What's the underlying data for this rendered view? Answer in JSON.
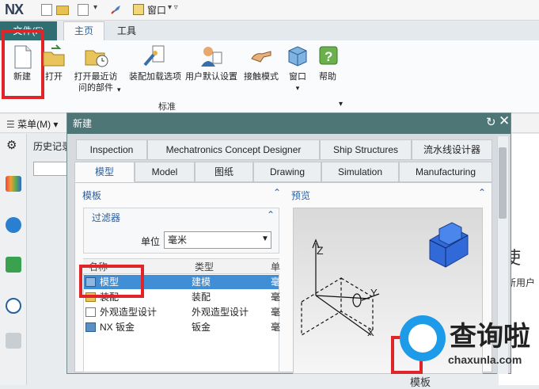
{
  "titlebar": {
    "logo": "NX",
    "window_label": "窗口"
  },
  "ribbon": {
    "tabs": {
      "file": "文件(F)",
      "home": "主页",
      "tools": "工具"
    },
    "buttons": {
      "new": "新建",
      "open": "打开",
      "open_recent_1": "打开最近访",
      "open_recent_2": "问的部件",
      "assembly_load": "装配加载选项",
      "user_defaults": "用户默认设置",
      "touch_mode": "接触模式",
      "window": "窗口",
      "help": "帮助"
    },
    "group_label": "标准"
  },
  "menubar": {
    "menu": "菜单(M)"
  },
  "background": {
    "history": "历史记录",
    "right_big": "使",
    "right_small": "新用户"
  },
  "dialog": {
    "title": "新建",
    "tabs_row1": [
      "Inspection",
      "Mechatronics Concept Designer",
      "Ship Structures",
      "流水线设计器"
    ],
    "tabs_row2": [
      "模型",
      "Model",
      "图纸",
      "Drawing",
      "Simulation",
      "Manufacturing"
    ],
    "templates": {
      "title": "模板",
      "filter": "过滤器",
      "unit_label": "单位",
      "unit_value": "毫米",
      "columns": [
        "名称",
        "类型",
        "单"
      ],
      "rows": [
        {
          "name": "模型",
          "type": "建模",
          "unit": "毫",
          "selected": true
        },
        {
          "name": "装配",
          "type": "装配",
          "unit": "毫",
          "selected": false
        },
        {
          "name": "外观造型设计",
          "type": "外观造型设计",
          "unit": "毫",
          "selected": false
        },
        {
          "name": "NX 钣金",
          "type": "钣金",
          "unit": "毫",
          "selected": false
        }
      ]
    },
    "preview": {
      "title": "预览",
      "axis_z": "Z",
      "axis_y": "Y",
      "axis_x": "X"
    },
    "bottom_label": "模板"
  },
  "watermark": {
    "cn": "查询啦",
    "url": "chaxunla.com"
  },
  "colors": {
    "accent_red": "#e0252a",
    "dialog_title": "#4f7677",
    "selection": "#3f8ed6",
    "file_tab": "#2f6f72"
  }
}
